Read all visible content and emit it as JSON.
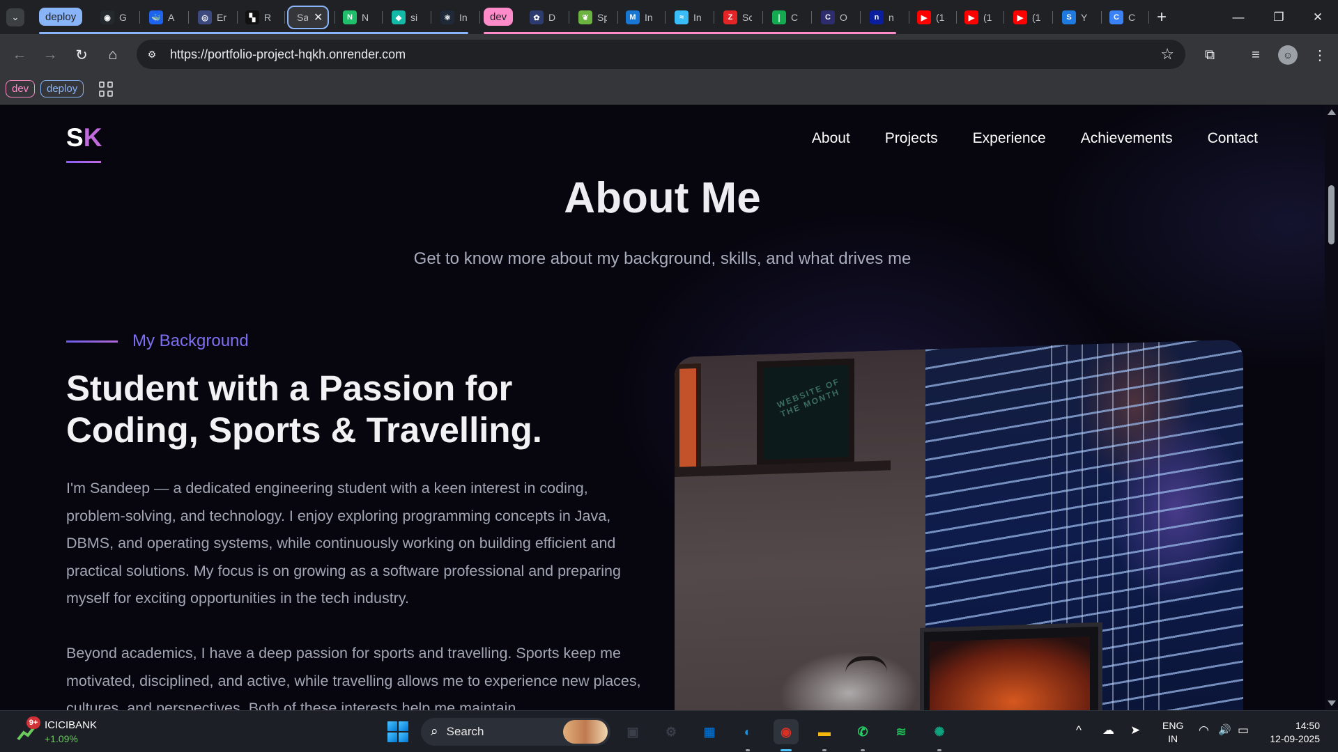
{
  "browser": {
    "tab_groups": {
      "deploy": {
        "label": "deploy",
        "color": "#8ab4f8"
      },
      "dev": {
        "label": "dev",
        "color": "#ff8bcb"
      }
    },
    "tabs": [
      {
        "icon": "github-icon",
        "glyph": "◉",
        "color": "#24292e",
        "title": "G"
      },
      {
        "icon": "docker-icon",
        "glyph": "🐳",
        "color": "#1d63ed",
        "title": "A"
      },
      {
        "icon": "generic-icon",
        "glyph": "◎",
        "color": "#3c4a80",
        "title": "Er"
      },
      {
        "icon": "render-icon",
        "glyph": "▚",
        "color": "#111111",
        "title": "R"
      },
      {
        "icon": "site-icon",
        "glyph": "",
        "color": "#35363a",
        "title": "Sa",
        "active": true
      },
      {
        "icon": "notion-icon",
        "glyph": "N",
        "color": "#1fbf6b",
        "title": "N"
      },
      {
        "icon": "diamond-icon",
        "glyph": "◆",
        "color": "#14b8a6",
        "title": "si"
      },
      {
        "icon": "react-icon",
        "glyph": "⚛",
        "color": "#1f2937",
        "title": "In"
      },
      {
        "icon": "dev-group-tab",
        "glyph": "",
        "color": "#ff8bcb",
        "title": "dev"
      },
      {
        "icon": "gear-flower-icon",
        "glyph": "✿",
        "color": "#2d3b6e",
        "title": "D"
      },
      {
        "icon": "spring-icon",
        "glyph": "❦",
        "color": "#6db33f",
        "title": "Sp"
      },
      {
        "icon": "mui-icon",
        "glyph": "M",
        "color": "#1976d2",
        "title": "In"
      },
      {
        "icon": "tailwind-icon",
        "glyph": "≈",
        "color": "#38bdf8",
        "title": "In"
      },
      {
        "icon": "zoho-icon",
        "glyph": "Z",
        "color": "#e42527",
        "title": "Sc"
      },
      {
        "icon": "mongodb-icon",
        "glyph": "❘",
        "color": "#13aa52",
        "title": "C"
      },
      {
        "icon": "circle-c-icon",
        "glyph": "C",
        "color": "#2d2d6e",
        "title": "O"
      },
      {
        "icon": "n-icon",
        "glyph": "n",
        "color": "#0b1e9e",
        "title": "n"
      },
      {
        "icon": "youtube-icon",
        "glyph": "▶",
        "color": "#ff0000",
        "title": "(1"
      },
      {
        "icon": "youtube-icon",
        "glyph": "▶",
        "color": "#ff0000",
        "title": "(1"
      },
      {
        "icon": "youtube-icon",
        "glyph": "▶",
        "color": "#ff0000",
        "title": "(1"
      },
      {
        "icon": "s-icon",
        "glyph": "S",
        "color": "#1f7ae0",
        "title": "Y"
      },
      {
        "icon": "c-logo-icon",
        "glyph": "C",
        "color": "#3b82f6",
        "title": "C"
      }
    ],
    "active_tab_close": "✕",
    "new_tab": "+",
    "window_controls": {
      "minimize": "—",
      "maximize": "❐",
      "close": "✕"
    },
    "toolbar": {
      "back": "←",
      "forward": "→",
      "reload": "↻",
      "home": "⌂",
      "url": "https://portfolio-project-hqkh.onrender.com",
      "site_info": "⚙",
      "bookmark": "☆",
      "extensions": "⧉",
      "media": "≡",
      "menu": "⋮",
      "profile": "☺"
    },
    "bookmarks": [
      {
        "label": "dev",
        "color": "#ff8bcb"
      },
      {
        "label": "deploy",
        "color": "#8ab4f8"
      }
    ]
  },
  "page": {
    "logo": {
      "first": "S",
      "second": "K"
    },
    "nav": [
      "About",
      "Projects",
      "Experience",
      "Achievements",
      "Contact"
    ],
    "section_title": "About Me",
    "section_subtitle": "Get to know more about my background, skills, and what drives me",
    "kicker": "My Background",
    "headline": "Student with a Passion for Coding, Sports & Travelling.",
    "paragraphs": [
      "I'm Sandeep — a dedicated engineering student with a keen interest in coding, problem-solving, and technology. I enjoy exploring programming concepts in Java, DBMS, and operating systems, while continuously working on building efficient and practical solutions. My focus is on growing as a software professional and preparing myself for exciting opportunities in the tech industry.",
      "Beyond academics, I have a deep passion for sports and travelling. Sports keep me motivated, disciplined, and active, while travelling allows me to experience new places, cultures, and perspectives. Both of these interests help me maintain"
    ],
    "photo_frame_text": "WEBSITE OF THE MONTH",
    "accent_colors": {
      "logo_k": "#c06bdc",
      "kicker": "#7c6ff0",
      "background": "#07060f"
    }
  },
  "taskbar": {
    "stock": {
      "name": "ICICIBANK",
      "change": "+1.09%",
      "badge": "9+"
    },
    "search": "Search",
    "apps": [
      {
        "name": "task-view-icon",
        "glyph": "▣",
        "color": "#3a3f4a"
      },
      {
        "name": "settings-icon",
        "glyph": "⚙",
        "color": "#3a3f4a"
      },
      {
        "name": "store-icon",
        "glyph": "▦",
        "color": "#0067c0"
      },
      {
        "name": "edge-icon",
        "glyph": "◐",
        "color": "#1f8fd6"
      },
      {
        "name": "chrome-icon",
        "glyph": "◉",
        "color": "#d93025",
        "active": true
      },
      {
        "name": "file-explorer-icon",
        "glyph": "▬",
        "color": "#f2b90c"
      },
      {
        "name": "whatsapp-icon",
        "glyph": "✆",
        "color": "#25d366"
      },
      {
        "name": "spotify-icon",
        "glyph": "≋",
        "color": "#1db954"
      },
      {
        "name": "chatgpt-icon",
        "glyph": "✺",
        "color": "#10a37f"
      }
    ],
    "tray": {
      "chevron": "^",
      "cloud": "☁",
      "location": "➤",
      "wifi": "◠",
      "volume": "🔊",
      "battery": "▭"
    },
    "language": {
      "line1": "ENG",
      "line2": "IN"
    },
    "time": "14:50",
    "date": "12-09-2025"
  }
}
